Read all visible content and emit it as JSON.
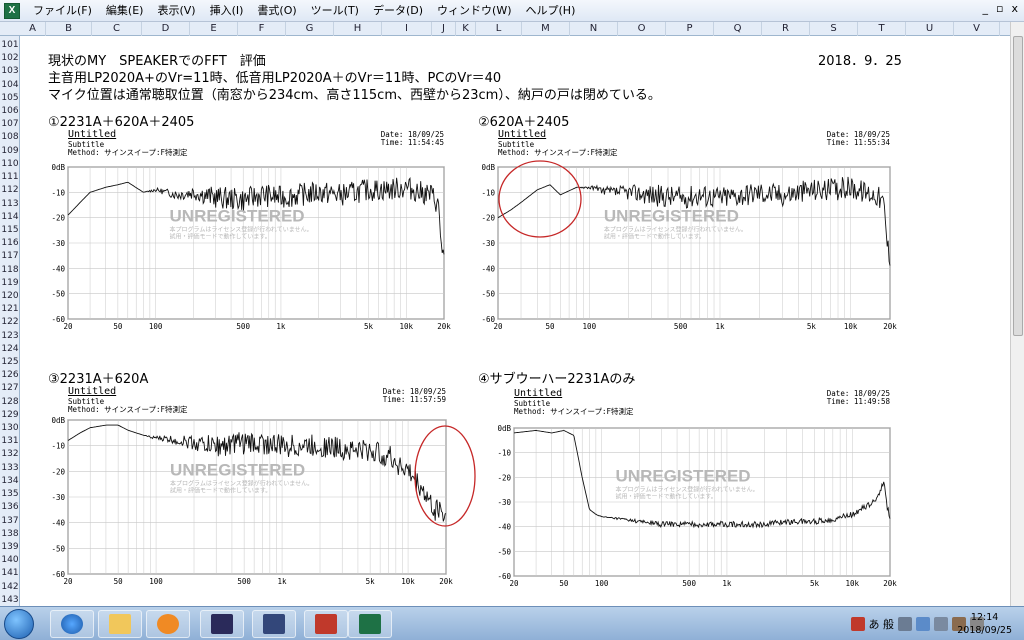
{
  "menu": [
    "ファイル(F)",
    "編集(E)",
    "表示(V)",
    "挿入(I)",
    "書式(O)",
    "ツール(T)",
    "データ(D)",
    "ウィンドウ(W)",
    "ヘルプ(H)"
  ],
  "app_icon": "X",
  "window_controls": [
    "_",
    "▫",
    "x"
  ],
  "columns": [
    "A",
    "B",
    "C",
    "D",
    "E",
    "F",
    "G",
    "H",
    "I",
    "J",
    "K",
    "L",
    "M",
    "N",
    "O",
    "P",
    "Q",
    "R",
    "S",
    "T",
    "U",
    "V"
  ],
  "rows": [
    "101",
    "102",
    "103",
    "104",
    "105",
    "106",
    "107",
    "108",
    "109",
    "110",
    "111",
    "112",
    "113",
    "114",
    "115",
    "116",
    "117",
    "118",
    "119",
    "120",
    "121",
    "122",
    "123",
    "124",
    "125",
    "126",
    "127",
    "128",
    "129",
    "130",
    "131",
    "132",
    "133",
    "134",
    "135",
    "136",
    "137",
    "138",
    "139",
    "140",
    "141",
    "142",
    "143"
  ],
  "sheet": {
    "title": "現状のMY　SPEAKERでのFFT　評価",
    "date": "2018．9．25",
    "line1": "主音用LP2020A+のVr=11時、低音用LP2020A＋のVr＝11時、PCのVr＝40",
    "line2": "マイク位置は通常聴取位置（南窓から234cm、高さ115cm、西壁から23cm）、納戸の戸は閉めている。"
  },
  "plots": [
    {
      "label": "①2231A＋620A＋2405",
      "ptitle": "Untitled",
      "subtitle": "Subtitle",
      "method": "Method: サインスイープ:F特測定",
      "date": "Date: 18/09/25",
      "time": "Time: 11:54:45",
      "watermark": "UNREGISTERED",
      "notice1": "本プログラムはライセンス登録が行われていません。",
      "notice2": "試用・評価モードで動作しています。"
    },
    {
      "label": "②620A＋2405",
      "ptitle": "Untitled",
      "subtitle": "Subtitle",
      "method": "Method: サインスイープ:F特測定",
      "date": "Date: 18/09/25",
      "time": "Time: 11:55:34",
      "watermark": "UNREGISTERED",
      "notice1": "本プログラムはライセンス登録が行われていません。",
      "notice2": "試用・評価モードで動作しています。"
    },
    {
      "label": "③2231A＋620A",
      "ptitle": "Untitled",
      "subtitle": "Subtitle",
      "method": "Method: サインスイープ:F特測定",
      "date": "Date: 18/09/25",
      "time": "Time: 11:57:59",
      "watermark": "UNREGISTERED",
      "notice1": "本プログラムはライセンス登録が行われていません。",
      "notice2": "試用・評価モードで動作しています。"
    },
    {
      "label": "④サブウーハー2231Aのみ",
      "ptitle": "Untitled",
      "subtitle": "Subtitle",
      "method": "Method: サインスイープ:F特測定",
      "date": "Date: 18/09/25",
      "time": "Time: 11:49:58",
      "watermark": "UNREGISTERED",
      "notice1": "本プログラムはライセンス登録が行われていません。",
      "notice2": "試用・評価モードで動作しています。"
    }
  ],
  "chart_data": [
    {
      "type": "line",
      "title": "Untitled",
      "x_ticks": [
        "20",
        "50",
        "100",
        "500",
        "1k",
        "5k",
        "10k",
        "20k"
      ],
      "y_ticks": [
        "0dB",
        "-10",
        "-20",
        "-30",
        "-40",
        "-50",
        "-60"
      ],
      "ylim": [
        -60,
        0
      ],
      "xlim": [
        20,
        20000
      ],
      "x_scale": "log",
      "series": [
        {
          "x": [
            20,
            25,
            30,
            40,
            50,
            60,
            80,
            100,
            150,
            200,
            300,
            500,
            700,
            1000,
            2000,
            3000,
            5000,
            7000,
            10000,
            13000,
            16000,
            18000,
            19000,
            20000
          ],
          "y": [
            -19,
            -14,
            -10,
            -8,
            -7,
            -6,
            -10,
            -9,
            -11,
            -10,
            -12,
            -13,
            -11,
            -12,
            -10,
            -11,
            -9,
            -9,
            -8,
            -10,
            -11,
            -15,
            -30,
            -36
          ]
        }
      ]
    },
    {
      "type": "line",
      "title": "Untitled",
      "x_ticks": [
        "20",
        "50",
        "100",
        "500",
        "1k",
        "5k",
        "10k",
        "20k"
      ],
      "y_ticks": [
        "0dB",
        "-10",
        "-20",
        "-30",
        "-40",
        "-50",
        "-60"
      ],
      "ylim": [
        -60,
        0
      ],
      "xlim": [
        20,
        20000
      ],
      "x_scale": "log",
      "series": [
        {
          "x": [
            20,
            25,
            30,
            40,
            50,
            60,
            80,
            100,
            150,
            200,
            300,
            500,
            700,
            1000,
            2000,
            3000,
            5000,
            7000,
            10000,
            13000,
            16000,
            18000,
            19000,
            20000
          ],
          "y": [
            -20,
            -17,
            -14,
            -9,
            -7,
            -11,
            -8,
            -8,
            -10,
            -10,
            -11,
            -12,
            -11,
            -12,
            -10,
            -11,
            -9,
            -9,
            -8,
            -10,
            -11,
            -15,
            -30,
            -36
          ]
        }
      ]
    },
    {
      "type": "line",
      "title": "Untitled",
      "x_ticks": [
        "20",
        "50",
        "100",
        "500",
        "1k",
        "5k",
        "10k",
        "20k"
      ],
      "y_ticks": [
        "0dB",
        "-10",
        "-20",
        "-30",
        "-40",
        "-50",
        "-60"
      ],
      "ylim": [
        -60,
        0
      ],
      "xlim": [
        20,
        20000
      ],
      "x_scale": "log",
      "series": [
        {
          "x": [
            20,
            25,
            30,
            40,
            50,
            60,
            80,
            100,
            150,
            200,
            300,
            500,
            700,
            1000,
            2000,
            3000,
            5000,
            7000,
            10000,
            13000,
            16000,
            18000,
            19000,
            20000
          ],
          "y": [
            -8,
            -5,
            -3,
            -2,
            -2,
            -4,
            -6,
            -7,
            -8,
            -9,
            -10,
            -9,
            -9,
            -10,
            -10,
            -11,
            -12,
            -14,
            -20,
            -27,
            -35,
            -34,
            -37,
            -38
          ]
        }
      ]
    },
    {
      "type": "line",
      "title": "Untitled",
      "x_ticks": [
        "20",
        "50",
        "100",
        "500",
        "1k",
        "5k",
        "10k",
        "20k"
      ],
      "y_ticks": [
        "0dB",
        "-10",
        "-20",
        "-30",
        "-40",
        "-50",
        "-60"
      ],
      "ylim": [
        -60,
        0
      ],
      "xlim": [
        20,
        20000
      ],
      "x_scale": "log",
      "series": [
        {
          "x": [
            20,
            30,
            40,
            50,
            60,
            70,
            80,
            90,
            100,
            150,
            200,
            300,
            500,
            700,
            1000,
            2000,
            3000,
            5000,
            7000,
            10000,
            15000,
            18000,
            19000,
            20000
          ],
          "y": [
            -2,
            -1,
            -2,
            -1,
            -3,
            -20,
            -33,
            -35,
            -36,
            -37,
            -38,
            -39,
            -39,
            -39,
            -39,
            -39,
            -38,
            -38,
            -37,
            -35,
            -30,
            -22,
            -32,
            -36
          ]
        }
      ]
    }
  ],
  "taskbar": {
    "clock_time": "12:14",
    "clock_date": "2018/09/25",
    "ime": "あ 般"
  },
  "colors": {
    "circle": "#c62828",
    "grid": "#c8c8c8",
    "trace": "#111111",
    "watermark": "#b8b8b8",
    "excel": "#1e7145"
  }
}
